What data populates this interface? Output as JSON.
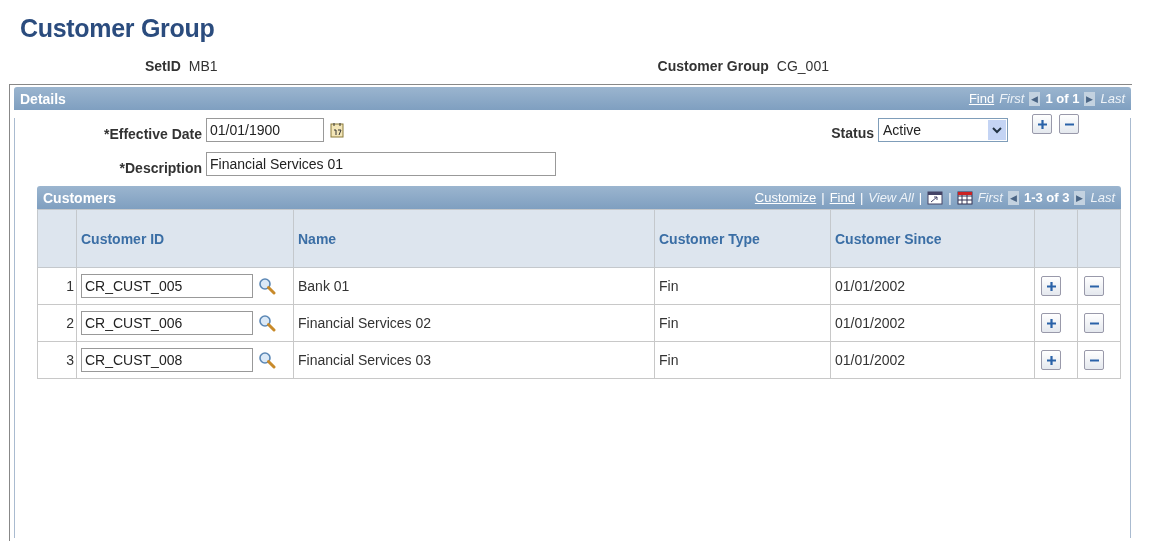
{
  "page_title": "Customer Group",
  "header_fields": [
    {
      "label": "SetID",
      "value": "MB1"
    },
    {
      "label": "Customer Group",
      "value": "CG_001"
    }
  ],
  "details": {
    "title": "Details",
    "nav": [
      {
        "label": "Find",
        "kind": "link",
        "disabled": false
      },
      {
        "label": "First",
        "kind": "link",
        "disabled": true
      },
      {
        "label": "◀",
        "kind": "arrow",
        "disabled": true
      },
      {
        "label": "1 of 1",
        "kind": "count"
      },
      {
        "label": "▶",
        "kind": "arrow",
        "disabled": true
      },
      {
        "label": "Last",
        "kind": "link",
        "disabled": true
      }
    ],
    "effective_date": {
      "label": "*Effective Date",
      "value": "01/01/1900"
    },
    "status": {
      "label": "Status",
      "value": "Active"
    },
    "description": {
      "label": "*Description",
      "value": "Financial Services 01"
    }
  },
  "customers": {
    "title": "Customers",
    "nav": [
      {
        "label": "Customize",
        "kind": "link",
        "disabled": false
      },
      {
        "label": "|",
        "kind": "sep"
      },
      {
        "label": "Find",
        "kind": "link",
        "disabled": false
      },
      {
        "label": "|",
        "kind": "sep"
      },
      {
        "label": "View All",
        "kind": "link",
        "disabled": true
      },
      {
        "label": "|",
        "kind": "sep"
      },
      {
        "kind": "zoom"
      },
      {
        "label": "|",
        "kind": "sep"
      },
      {
        "kind": "grid"
      },
      {
        "label": "First",
        "kind": "link",
        "disabled": true
      },
      {
        "label": "◀",
        "kind": "arrow",
        "disabled": true
      },
      {
        "label": "1-3 of 3",
        "kind": "count"
      },
      {
        "label": "▶",
        "kind": "arrow",
        "disabled": true
      },
      {
        "label": "Last",
        "kind": "link",
        "disabled": true
      }
    ],
    "columns": [
      "Customer ID",
      "Name",
      "Customer Type",
      "Customer Since"
    ],
    "rows": [
      {
        "number": "1",
        "customer_id": "CR_CUST_005",
        "name": "Bank 01",
        "type": "Fin",
        "since": "01/01/2002"
      },
      {
        "number": "2",
        "customer_id": "CR_CUST_006",
        "name": "Financial Services 02",
        "type": "Fin",
        "since": "01/01/2002"
      },
      {
        "number": "3",
        "customer_id": "CR_CUST_008",
        "name": "Financial Services 03",
        "type": "Fin",
        "since": "01/01/2002"
      }
    ]
  }
}
